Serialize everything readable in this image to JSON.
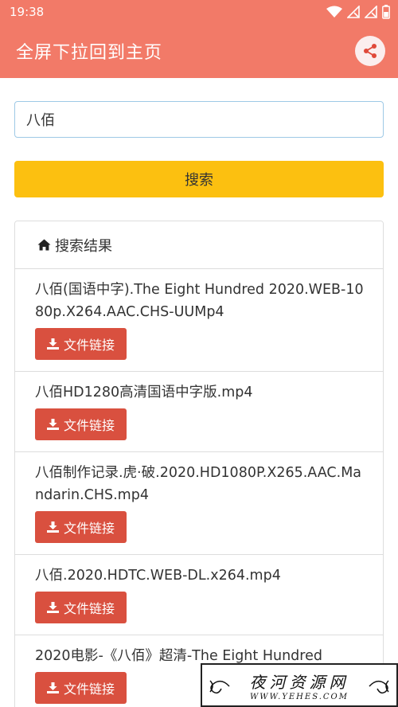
{
  "status_bar": {
    "time": "19:38"
  },
  "app_bar": {
    "title": "全屏下拉回到主页",
    "share_icon": "share-icon"
  },
  "search": {
    "value": "八佰",
    "button_label": "搜索"
  },
  "results_panel": {
    "heading": "搜索结果",
    "heading_icon": "home-icon",
    "items": [
      {
        "title": "八佰(国语中字).The Eight Hundred 2020.WEB-1080p.X264.AAC.CHS-UUMp4",
        "button_label": "文件链接"
      },
      {
        "title": "八佰HD1280高清国语中字版.mp4",
        "button_label": "文件链接"
      },
      {
        "title": "八佰制作记录.虎·破.2020.HD1080P.X265.AAC.Mandarin.CHS.mp4",
        "button_label": "文件链接"
      },
      {
        "title": "八佰.2020.HDTC.WEB-DL.x264.mp4",
        "button_label": "文件链接"
      },
      {
        "title": "2020电影-《八佰》超清-The Eight Hundred",
        "button_label": "文件链接"
      }
    ]
  },
  "watermark": {
    "main": "夜河资源网",
    "sub": "WWW.YEHES.COM"
  },
  "colors": {
    "app_bar": "#f27a68",
    "search_button": "#fcc010",
    "download_button": "#d9503f",
    "input_border": "#9ec9e6"
  }
}
